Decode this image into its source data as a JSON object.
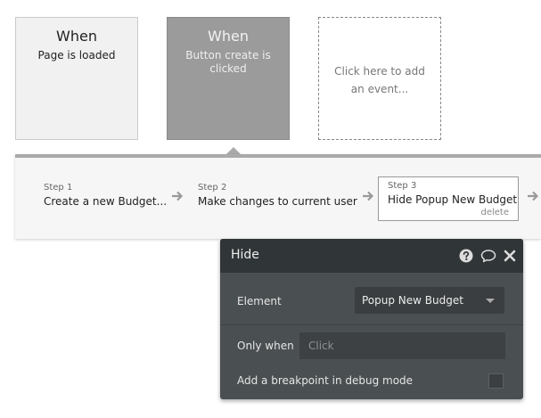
{
  "events": [
    {
      "when": "When",
      "description": "Page is loaded"
    },
    {
      "when": "When",
      "description": "Button create is clicked"
    }
  ],
  "add_event": {
    "label": "Click here to add an event..."
  },
  "steps": [
    {
      "number": "Step 1",
      "title": "Create a new Budget..."
    },
    {
      "number": "Step 2",
      "title": "Make changes to current user"
    },
    {
      "number": "Step 3",
      "title": "Hide Popup New Budget",
      "delete_label": "delete"
    }
  ],
  "panel": {
    "title": "Hide",
    "element_label": "Element",
    "element_value": "Popup New Budget",
    "only_when_label": "Only when",
    "only_when_placeholder": "Click",
    "breakpoint_label": "Add a breakpoint in debug mode",
    "icons": [
      "help-icon",
      "comment-icon",
      "close-icon"
    ]
  },
  "colors": {
    "selected_event": "#9b9b9b",
    "panel_bg": "#4a4f51",
    "panel_header": "#303537"
  }
}
